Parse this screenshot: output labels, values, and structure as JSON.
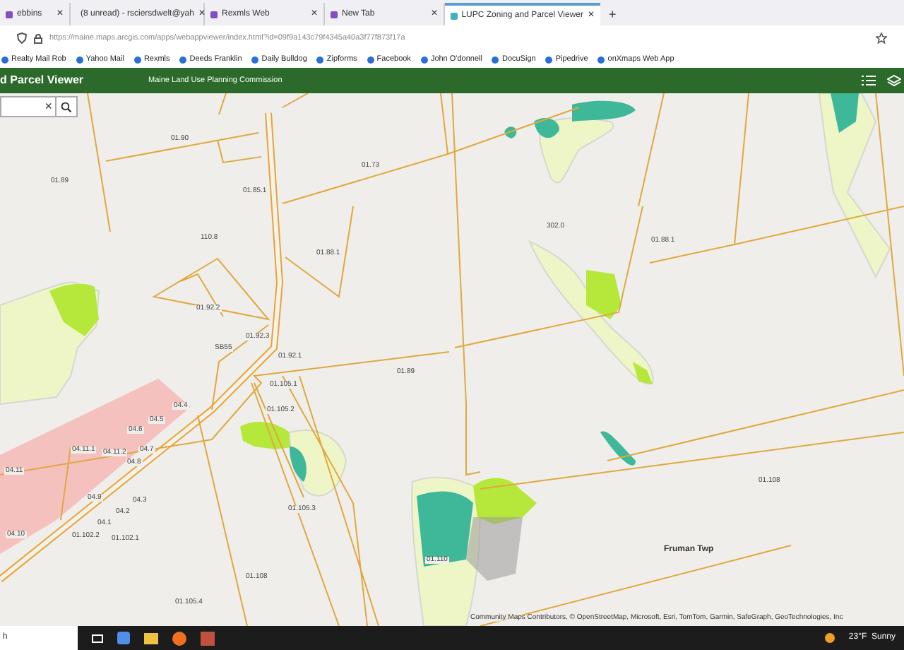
{
  "browser": {
    "tabs": [
      {
        "title": "ebbins",
        "close": "✕",
        "selected": false
      },
      {
        "title": "(8 unread) - rsciersdwelt@yah",
        "close": "✕",
        "selected": false
      },
      {
        "title": "Rexmls Web",
        "close": "✕",
        "selected": false
      },
      {
        "title": "New Tab",
        "close": "✕",
        "selected": false
      },
      {
        "title": "LUPC Zoning and Parcel Viewer",
        "close": "✕",
        "selected": true
      }
    ],
    "new_tab": "+",
    "url": "https://maine.maps.arcgis.com/apps/webappviewer/index.html?id=09f9a143c79f4345a40a3f77f873f17a",
    "bookmarks": [
      "Realty Mail Rob",
      "Yahoo Mail",
      "Rexmls",
      "Deeds Franklin",
      "Daily Bulldog",
      "Zipforms",
      "Facebook",
      "John O'donnell",
      "DocuSign",
      "Pipedrive",
      "onXmaps Web App"
    ]
  },
  "app_header": {
    "title": "d Parcel Viewer",
    "subtitle": "Maine Land Use Planning Commission"
  },
  "search": {
    "clear": "×"
  },
  "map": {
    "parcel_labels": [
      "01.90",
      "01.89",
      "01.73",
      "01.85.1",
      "110.8",
      "01.88.1",
      "01.92.2",
      "01.92.3",
      "SB55",
      "01.92.1",
      "01.105.1",
      "01.89",
      "302.0",
      "01.88.1",
      "01.105.2",
      "04.4",
      "04.5",
      "04.6",
      "04.11.1",
      "04.11.2",
      "04.7",
      "04.8",
      "04.11",
      "04.9",
      "04.3",
      "04.2",
      "04.1",
      "01.102.2",
      "01.102.1",
      "04.10",
      "01.105.3",
      "01.108",
      "01.105.4",
      "01.110",
      "01.108"
    ],
    "town_label": "Fruman Twp",
    "attribution": "Community Maps Contributors, © OpenStreetMap, Microsoft, Esri, TomTom, Garmin, SafeGraph, GeoTechnologies, Inc"
  },
  "taskbar": {
    "search_text": "h",
    "weather": "23°F  Sunny"
  }
}
